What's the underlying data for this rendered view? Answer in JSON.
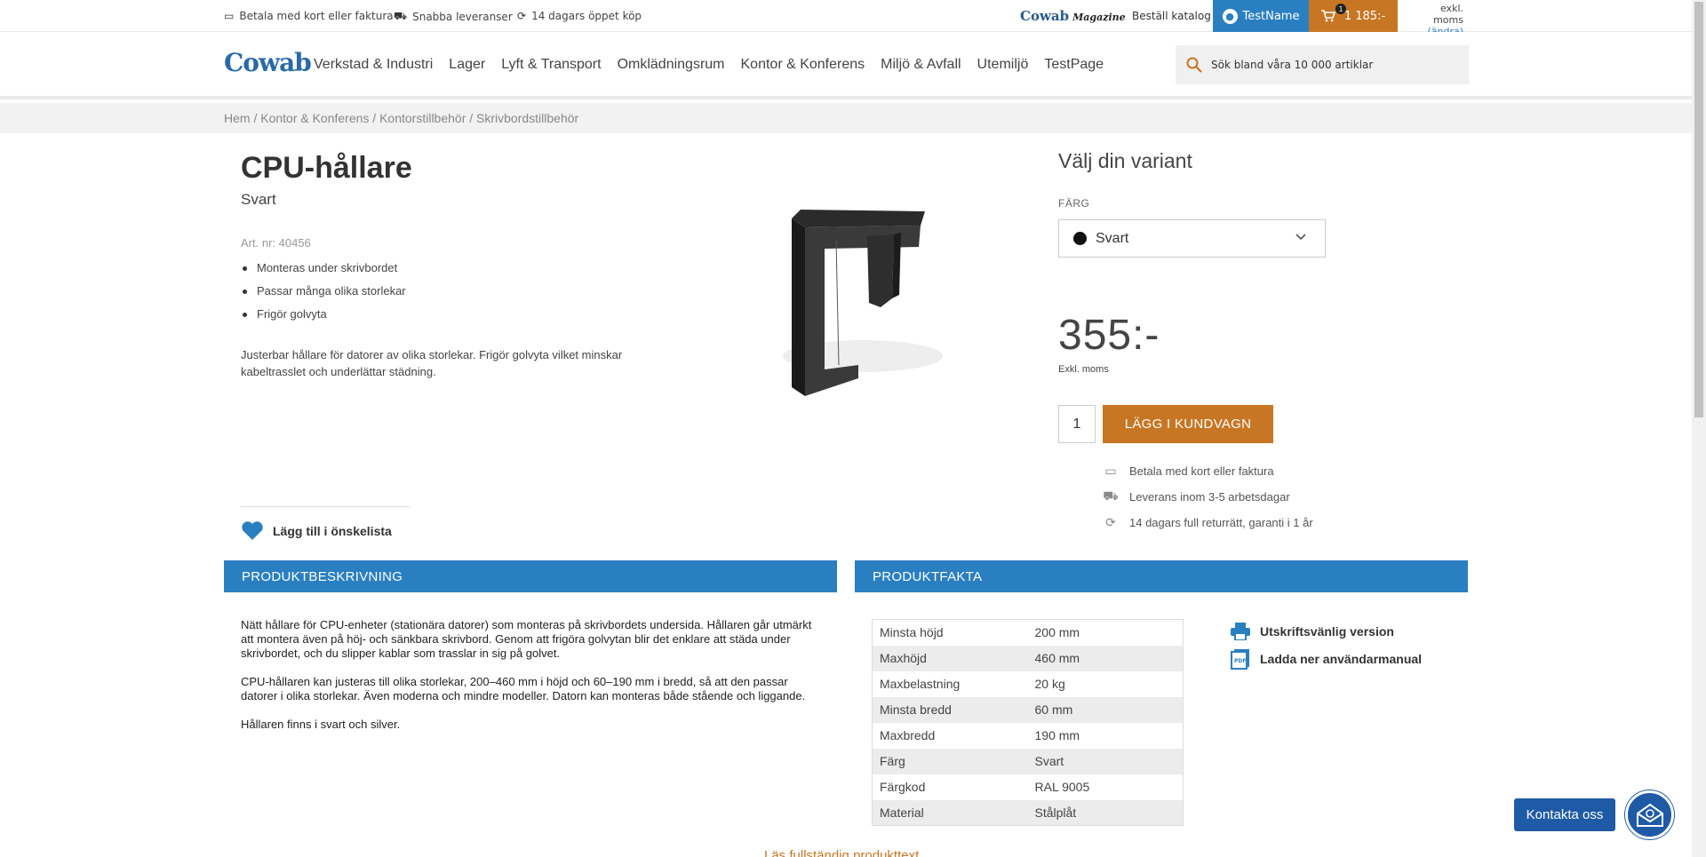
{
  "topbar": {
    "usps": [
      {
        "icon": "card-icon",
        "label": "Betala med kort eller faktura"
      },
      {
        "icon": "truck-icon",
        "label": "Snabba leveranser"
      },
      {
        "icon": "return-icon",
        "label": "14 dagars öppet köp"
      }
    ],
    "magazine": "Cowab",
    "magazine_suffix": "Magazine",
    "catalog": "Beställ katalog",
    "user": "TestName",
    "cart_count": "1",
    "cart_total": "1 185:-",
    "vat_label": "exkl. moms",
    "vat_change": "(ändra)"
  },
  "header": {
    "logo": "Cowab",
    "nav": [
      "Verkstad & Industri",
      "Lager",
      "Lyft & Transport",
      "Omklädningsrum",
      "Kontor & Konferens",
      "Miljö & Avfall",
      "Utemiljö",
      "TestPage"
    ],
    "search_placeholder": "Sök bland våra 10 000 artiklar"
  },
  "breadcrumb": "Hem / Kontor & Konferens / Kontorstillbehör / Skrivbordstillbehör",
  "product": {
    "title": "CPU-hållare",
    "subtitle": "Svart",
    "art_nr": "Art. nr: 40456",
    "bullets": [
      "Monteras under skrivbordet",
      "Passar många olika storlekar",
      "Frigör golvyta"
    ],
    "short_desc": "Justerbar hållare för datorer av olika storlekar. Frigör golvyta vilket minskar kabeltrasslet och underlättar städning.",
    "wishlist": "Lägg till i önskelista",
    "image_icon": "cpu-holder-image"
  },
  "purchase": {
    "variant_title": "Välj din variant",
    "color_label": "FÄRG",
    "color_value": "Svart",
    "color_swatch": "#111111",
    "price": "355:-",
    "price_note": "Exkl. moms",
    "quantity": "1",
    "add_to_cart": "LÄGG I KUNDVAGN",
    "perks": [
      {
        "icon": "card-icon",
        "label": "Betala med kort eller faktura"
      },
      {
        "icon": "truck-icon",
        "label": "Leverans inom 3-5 arbetsdagar"
      },
      {
        "icon": "return-icon",
        "label": "14 dagars full returrätt, garanti i 1 år"
      }
    ]
  },
  "description": {
    "heading": "PRODUKTBESKRIVNING",
    "paragraphs": [
      "Nätt hållare för CPU-enheter (stationära datorer) som monteras på skrivbordets undersida. Hållaren går utmärkt att montera även på höj- och sänkbara skrivbord. Genom att frigöra golvytan blir det enklare att städa under skrivbordet, och du slipper kablar som trasslar in sig på golvet.",
      "CPU-hållaren kan justeras till olika storlekar, 200–460 mm i höjd och 60–190 mm i bredd, så att den passar datorer i olika storlekar. Även moderna och mindre modeller. Datorn kan monteras både stående och liggande.",
      "Hållaren finns i svart och silver."
    ],
    "read_more": "Läs fullständig produkttext"
  },
  "facts": {
    "heading": "PRODUKTFAKTA",
    "rows": [
      [
        "Minsta höjd",
        "200 mm"
      ],
      [
        "Maxhöjd",
        "460 mm"
      ],
      [
        "Maxbelastning",
        "20 kg"
      ],
      [
        "Minsta bredd",
        "60 mm"
      ],
      [
        "Maxbredd",
        "190 mm"
      ],
      [
        "Färg",
        "Svart"
      ],
      [
        "Färgkod",
        "RAL 9005"
      ],
      [
        "Material",
        "Stålplåt"
      ]
    ],
    "print": "Utskriftsvänlig version",
    "manual": "Ladda ner användarmanual"
  },
  "contact": "Kontakta oss",
  "colors": {
    "brand_blue": "#2a7fc1",
    "brand_orange": "#c77624",
    "contact_blue": "#1f5aa6"
  }
}
